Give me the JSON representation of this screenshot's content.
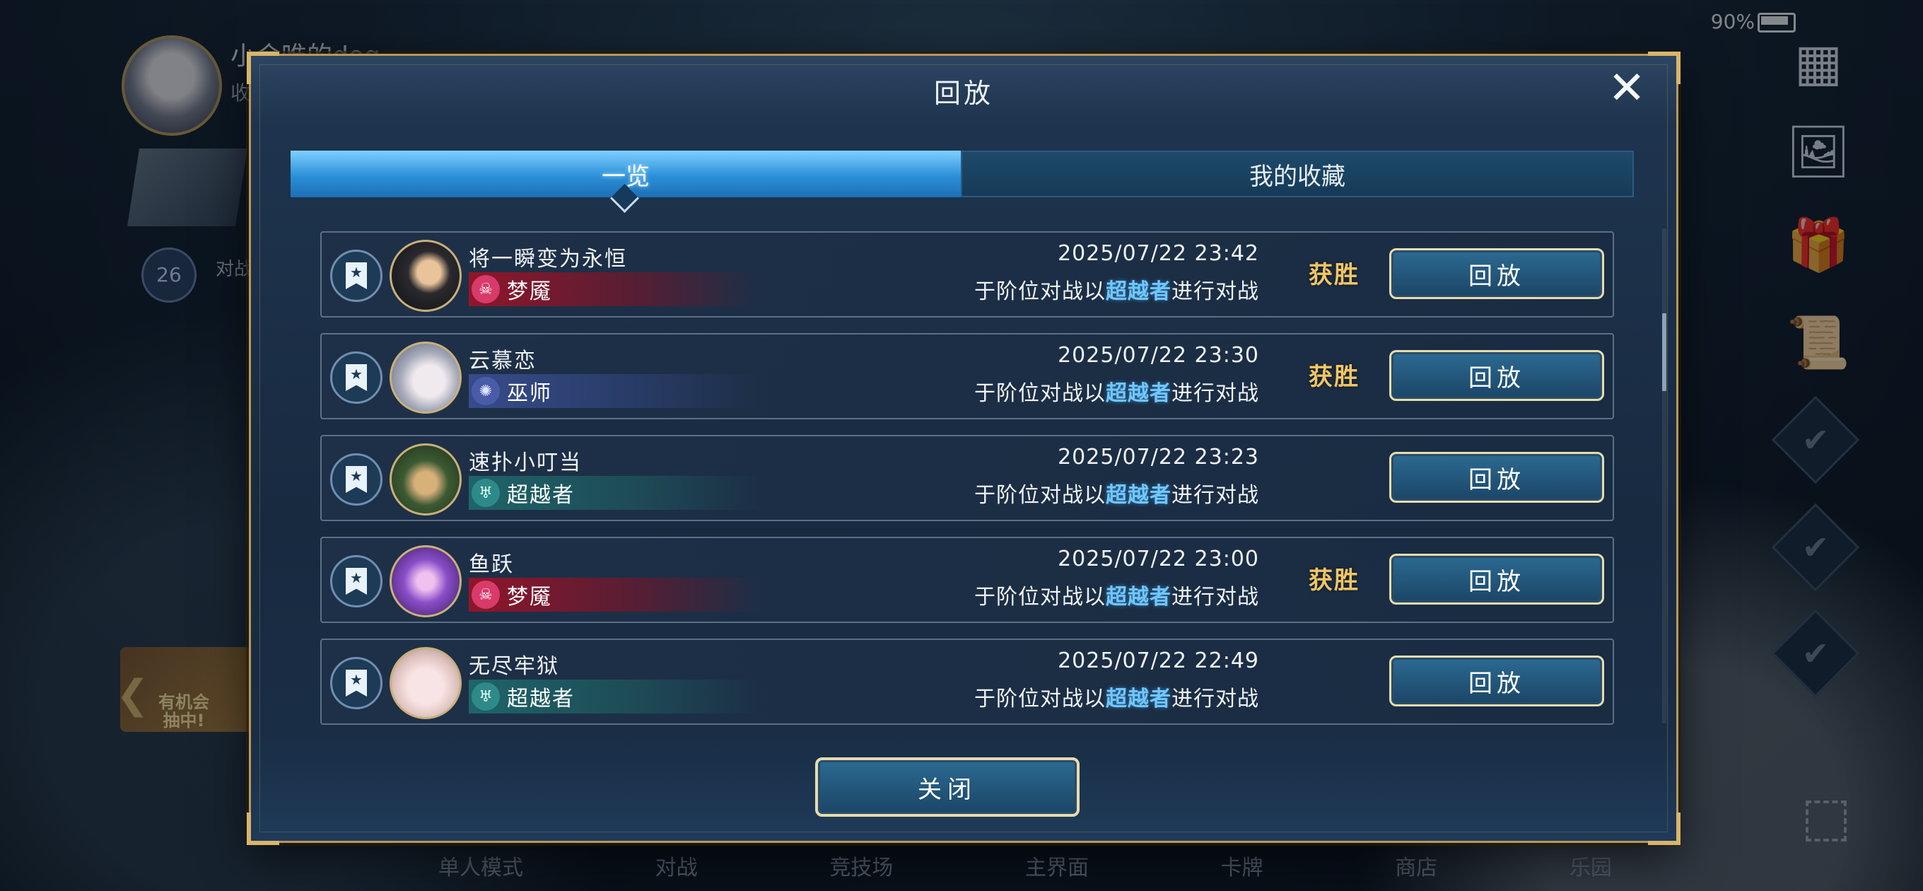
{
  "background": {
    "player_name": "小会唯的dog",
    "player_sub": "收",
    "level": "26",
    "task_text": "对战进行中",
    "promo_text": "有机会抽中!",
    "battery": "90%",
    "bottom_nav": [
      "单人模式",
      "对战",
      "竞技场",
      "主界面",
      "卡牌",
      "商店",
      "乐园"
    ]
  },
  "modal": {
    "title": "回放",
    "tabs": [
      {
        "label": "一览",
        "active": true
      },
      {
        "label": "我的收藏",
        "active": false
      }
    ],
    "replay_label": "回放",
    "close_label": "关闭",
    "matches": [
      {
        "opponent": "将一瞬变为永恒",
        "class": "梦魇",
        "class_type": "nightmare",
        "date": "2025/07/22  23:42",
        "mode_prefix": "于阶位对战以",
        "my_class": "超越者",
        "mode_suffix": "进行对战",
        "result": "获胜"
      },
      {
        "opponent": "云慕恋",
        "class": "巫师",
        "class_type": "wizard",
        "date": "2025/07/22  23:30",
        "mode_prefix": "于阶位对战以",
        "my_class": "超越者",
        "mode_suffix": "进行对战",
        "result": "获胜"
      },
      {
        "opponent": "速扑小叮当",
        "class": "超越者",
        "class_type": "transcend",
        "date": "2025/07/22  23:23",
        "mode_prefix": "于阶位对战以",
        "my_class": "超越者",
        "mode_suffix": "进行对战",
        "result": ""
      },
      {
        "opponent": "鱼跃",
        "class": "梦魇",
        "class_type": "nightmare",
        "date": "2025/07/22  23:00",
        "mode_prefix": "于阶位对战以",
        "my_class": "超越者",
        "mode_suffix": "进行对战",
        "result": "获胜"
      },
      {
        "opponent": "无尽牢狱",
        "class": "超越者",
        "class_type": "transcend",
        "date": "2025/07/22  22:49",
        "mode_prefix": "于阶位对战以",
        "my_class": "超越者",
        "mode_suffix": "进行对战",
        "result": ""
      }
    ]
  },
  "colors": {
    "accent": "#6fc7ff",
    "win": "#f2c664",
    "frame": "#b8985a"
  }
}
